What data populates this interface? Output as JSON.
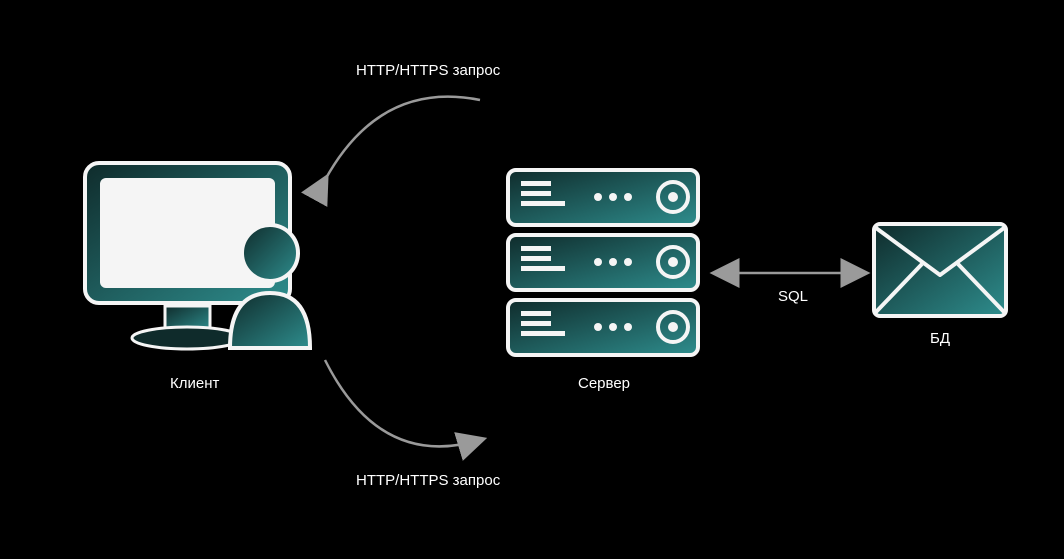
{
  "labels": {
    "client": "Клиент",
    "server": "Сервер",
    "database": "БД",
    "request_top": "HTTP/HTTPS запрос",
    "request_bottom": "HTTP/HTTPS запрос",
    "sql": "SQL"
  },
  "colors": {
    "grad_start": "#0f2b2b",
    "grad_end": "#2e8d8d",
    "stroke": "#f5f5f5",
    "arrow": "#9a9a9a"
  }
}
